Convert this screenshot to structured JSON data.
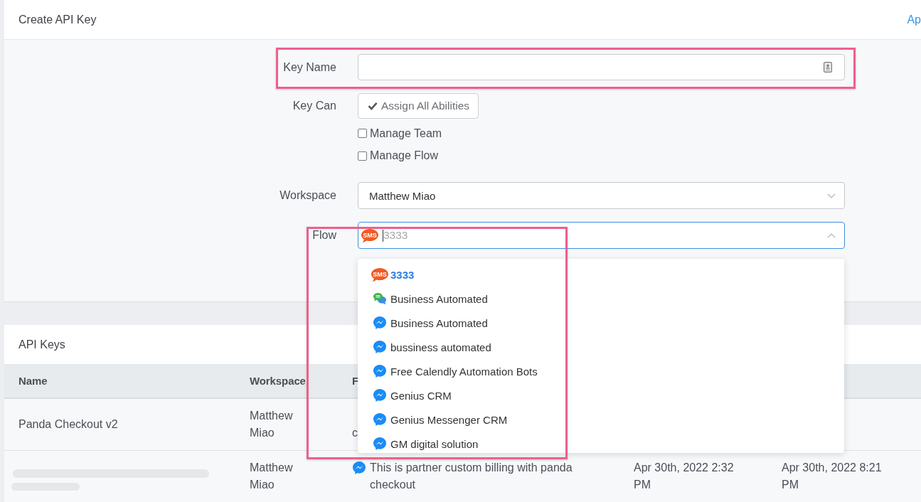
{
  "header": {
    "title": "Create API Key",
    "link": "Ap"
  },
  "form": {
    "key_name": {
      "label": "Key Name"
    },
    "key_can": {
      "label": "Key Can",
      "button": "Assign All Abilities",
      "abilities": [
        {
          "label": "Manage Team",
          "checked": false
        },
        {
          "label": "Manage Flow",
          "checked": false
        }
      ]
    },
    "workspace": {
      "label": "Workspace",
      "value": "Matthew Miao",
      "expanded": false
    },
    "flow": {
      "label": "Flow",
      "kind": "sms",
      "badge": "SMS",
      "value": "3333",
      "focused": true,
      "expanded": true,
      "options": [
        {
          "label": "3333",
          "kind": "sms",
          "badge": "SMS",
          "selected": true
        },
        {
          "label": "Business Automated",
          "kind": "chat",
          "selected": false
        },
        {
          "label": "Business Automated",
          "kind": "messenger",
          "selected": false
        },
        {
          "label": "bussiness automated",
          "kind": "messenger",
          "selected": false
        },
        {
          "label": "Free Calendly Automation Bots",
          "kind": "messenger",
          "selected": false
        },
        {
          "label": "Genius CRM",
          "kind": "messenger",
          "selected": false
        },
        {
          "label": "Genius Messenger CRM",
          "kind": "messenger",
          "selected": false
        },
        {
          "label": "GM digital solution",
          "kind": "messenger",
          "selected": false
        }
      ]
    }
  },
  "api_keys": {
    "title": "API Keys",
    "columns": [
      {
        "label": "Name"
      },
      {
        "label": "Workspace"
      },
      {
        "label": "F"
      }
    ],
    "rows": [
      {
        "name": "Panda Checkout v2",
        "workspace": "Matthew Miao",
        "column_3": {
          "text": "c"
        }
      },
      {
        "workspace": "Matthew Miao",
        "column_3": {
          "kind": "messenger",
          "text": "This is partner custom billing with panda checkout"
        },
        "column_4": "Apr 30th, 2022 2:32 PM",
        "column_5": "Apr 30th, 2022 8:21 PM"
      }
    ]
  }
}
